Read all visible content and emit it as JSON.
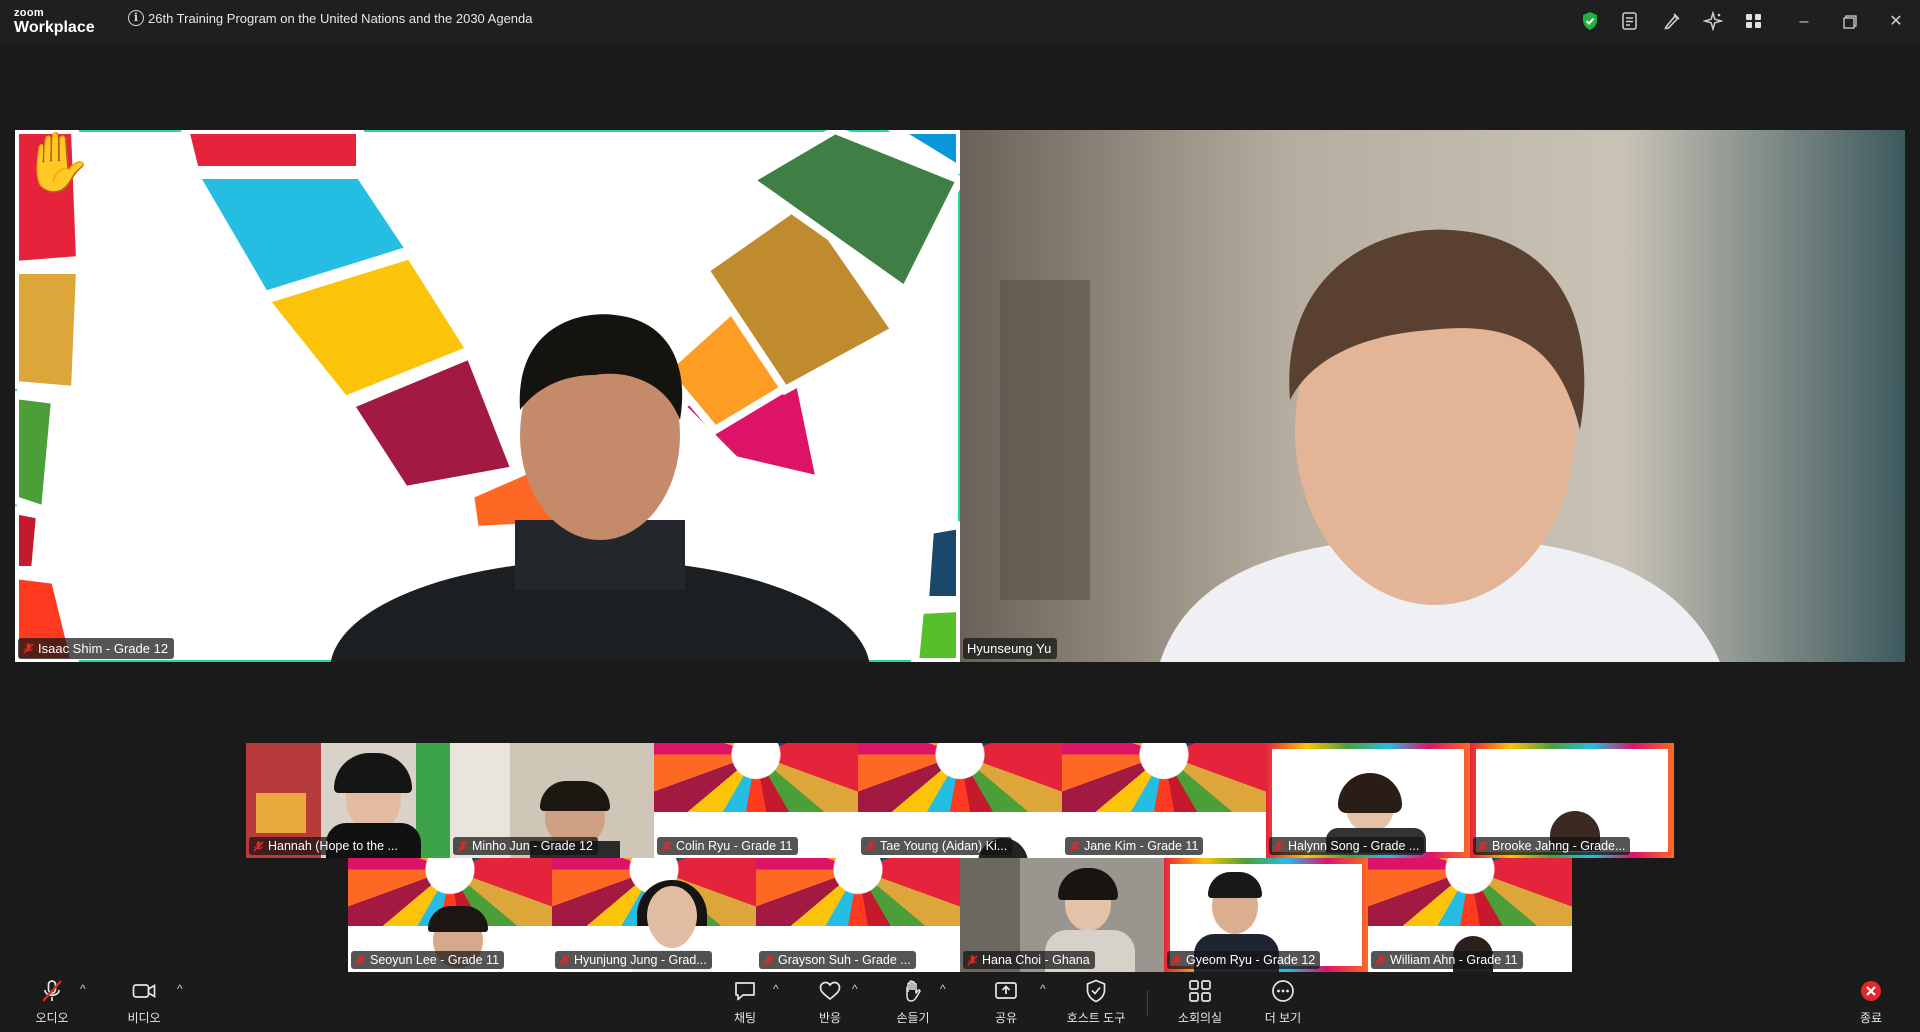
{
  "app": {
    "brand_small": "zoom",
    "brand_big": "Workplace"
  },
  "meeting": {
    "title": "26th Training Program on the United Nations and the 2030 Agenda"
  },
  "titlebar_icons": [
    "security-shield-icon",
    "notes-icon",
    "annotate-icon",
    "ai-companion-icon",
    "apps-icon"
  ],
  "window_controls": [
    "minimize",
    "maximize",
    "close"
  ],
  "main_tiles": [
    {
      "name": "Isaac Shim - Grade 12",
      "muted": true,
      "hand_raised": true,
      "speaking": true,
      "background": "sdg-wheel"
    },
    {
      "name": "Hyunseung Yu",
      "muted": false,
      "hand_raised": false,
      "speaking": false,
      "background": "room"
    }
  ],
  "gallery_row1": [
    {
      "name": "Hannah (Hope to the ...",
      "muted": true,
      "background": "room"
    },
    {
      "name": "Minho Jun - Grade 12",
      "muted": true,
      "background": "room-light"
    },
    {
      "name": "Colin Ryu - Grade 11",
      "muted": true,
      "background": "sdg-wheel"
    },
    {
      "name": "Tae Young (Aidan) Ki...",
      "muted": true,
      "background": "sdg-wheel"
    },
    {
      "name": "Jane Kim - Grade 11",
      "muted": true,
      "background": "sdg-wheel"
    },
    {
      "name": "Halynn Song - Grade ...",
      "muted": true,
      "background": "sdg-frame"
    },
    {
      "name": "Brooke Jahng - Grade...",
      "muted": true,
      "background": "sdg-frame"
    }
  ],
  "gallery_row2": [
    {
      "name": "Seoyun Lee - Grade 11",
      "muted": true,
      "background": "sdg-wheel"
    },
    {
      "name": "Hyunjung Jung - Grad...",
      "muted": true,
      "background": "sdg-wheel"
    },
    {
      "name": "Grayson Suh - Grade ...",
      "muted": true,
      "background": "sdg-wheel"
    },
    {
      "name": "Hana Choi - Ghana",
      "muted": true,
      "background": "room-grey"
    },
    {
      "name": "Gyeom Ryu - Grade 12",
      "muted": true,
      "background": "sdg-frame"
    },
    {
      "name": "William Ahn - Grade 11",
      "muted": true,
      "background": "sdg-wheel"
    }
  ],
  "toolbar": {
    "audio": "오디오",
    "video": "비디오",
    "chat": "채팅",
    "reactions": "반응",
    "raise_hand": "손들기",
    "share": "공유",
    "host_tools": "호스트 도구",
    "breakout": "소회의실",
    "more": "더 보기",
    "end": "종료"
  },
  "colors": {
    "active_speaker": "#23d9a0",
    "end_red": "#e02828",
    "mute_red": "#e02828",
    "shield_green": "#1fb141"
  }
}
